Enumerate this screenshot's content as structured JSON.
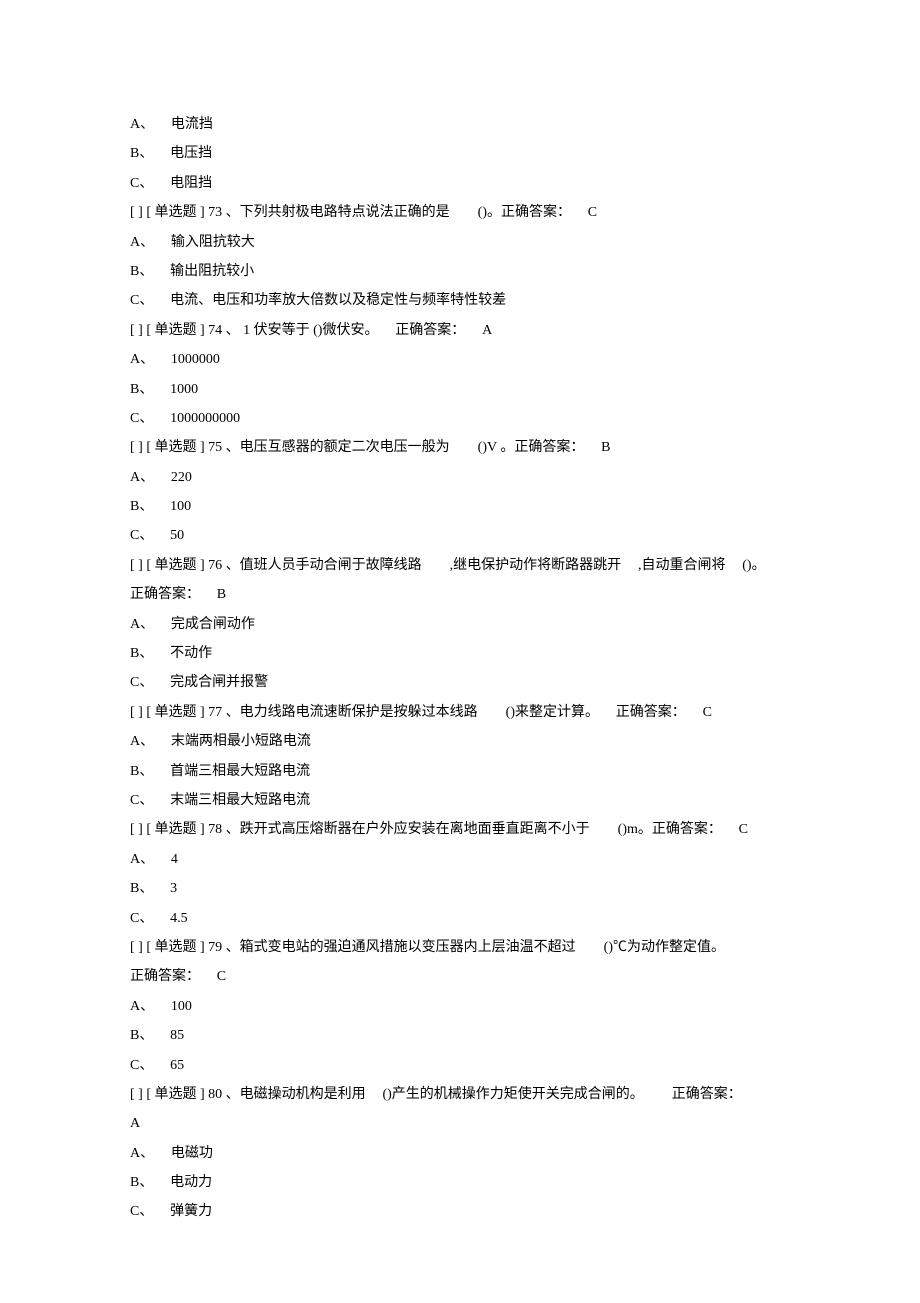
{
  "options72": {
    "A": "电流挡",
    "B": "电压挡",
    "C": "电阻挡"
  },
  "q73": {
    "prefix": "[ ] [ 单选题 ] 73 、下列共射极电路特点说法正确的是",
    "blank": "()。正确答案：",
    "ans": "C",
    "A": "输入阻抗较大",
    "B": "输出阻抗较小",
    "C": "电流、电压和功率放大倍数以及稳定性与频率特性较差"
  },
  "q74": {
    "prefix": "[ ] [ 单选题 ] 74 、 1 伏安等于 ()微伏安。",
    "ansLabel": "正确答案：",
    "ans": "A",
    "A": "1000000",
    "B": "1000",
    "C": "1000000000"
  },
  "q75": {
    "prefix": "[ ] [ 单选题 ] 75 、电压互感器的额定二次电压一般为",
    "blank": "()V 。正确答案：",
    "ans": "B",
    "A": "220",
    "B": "100",
    "C": "50"
  },
  "q76": {
    "prefix": "[ ] [ 单选题 ] 76 、值班人员手动合闸于故障线路",
    "mid1": ",继电保护动作将断路器跳开",
    "mid2": ",自动重合闸将",
    "tail": "()。",
    "ansLabel": "正确答案：",
    "ans": "B",
    "A": "完成合闸动作",
    "B": "不动作",
    "C": "完成合闸并报警"
  },
  "q77": {
    "prefix": "[ ] [ 单选题 ] 77 、电力线路电流速断保护是按躲过本线路",
    "blank": "()来整定计算。",
    "ansLabel": "正确答案：",
    "ans": "C",
    "A": "末端两相最小短路电流",
    "B": "首端三相最大短路电流",
    "C": "末端三相最大短路电流"
  },
  "q78": {
    "prefix": "[ ] [ 单选题 ] 78 、跌开式高压熔断器在户外应安装在离地面垂直距离不小于",
    "blank": "()m。正确答案：",
    "ans": "C",
    "A": "4",
    "B": "3",
    "C": "4.5"
  },
  "q79": {
    "prefix": "[ ] [ 单选题 ] 79 、箱式变电站的强迫通风措施以变压器内上层油温不超过",
    "blank": "()℃为动作整定值。",
    "ansLabel": "正确答案：",
    "ans": "C",
    "A": "100",
    "B": "85",
    "C": "65"
  },
  "q80": {
    "prefix": "[ ] [ 单选题 ] 80 、电磁操动机构是利用",
    "blank": "()产生的机械操作力矩使开关完成合闸的。",
    "ansLabel": "正确答案：",
    "ans": "A",
    "A": "电磁功",
    "B": "电动力",
    "C": "弹簧力"
  },
  "labels": {
    "A": "A、",
    "B": "B、",
    "C": "C、"
  }
}
